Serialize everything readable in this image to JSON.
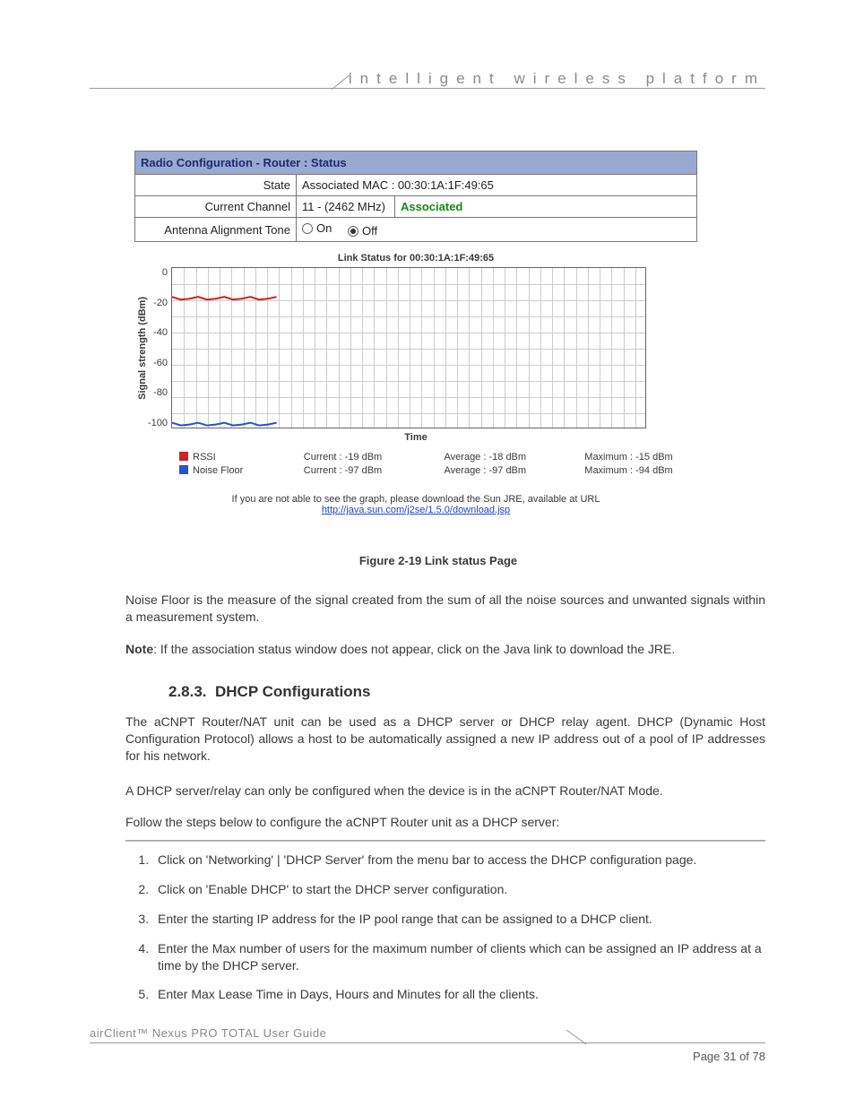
{
  "header": {
    "tagline": "intelligent wireless platform"
  },
  "config_table": {
    "title": "Radio Configuration - Router : Status",
    "rows": {
      "state_label": "State",
      "state_value": "Associated MAC : 00:30:1A:1F:49:65",
      "channel_label": "Current Channel",
      "channel_value": "11 - (2462 MHz)",
      "channel_status": "Associated",
      "tone_label": "Antenna Alignment Tone",
      "tone_on": "On",
      "tone_off": "Off"
    }
  },
  "chart_data": {
    "type": "line",
    "title": "Link Status for 00:30:1A:1F:49:65",
    "xlabel": "Time",
    "ylabel": "Signal strength (dBm)",
    "ylim": [
      -100,
      0
    ],
    "yticks": [
      "0",
      "-20",
      "-40",
      "-60",
      "-80",
      "-100"
    ],
    "series": [
      {
        "name": "RSSI",
        "color": "#c22",
        "approx_level": -19,
        "segment_frac": 0.22
      },
      {
        "name": "Noise Floor",
        "color": "#2255cc",
        "approx_level": -97,
        "segment_frac": 0.22
      }
    ],
    "legend": {
      "rssi": {
        "name": "RSSI",
        "current_label": "Current :",
        "current": "-19 dBm",
        "average_label": "Average :",
        "average": "-18 dBm",
        "maximum_label": "Maximum :",
        "maximum": "-15 dBm"
      },
      "noise": {
        "name": "Noise Floor",
        "current_label": "Current :",
        "current": "-97 dBm",
        "average_label": "Average :",
        "average": "-97 dBm",
        "maximum_label": "Maximum :",
        "maximum": "-94 dBm"
      }
    },
    "jre_note": "If you are not able to see the graph, please download the Sun JRE, available at URL",
    "jre_link": "http://java.sun.com/j2se/1.5.0/download.jsp"
  },
  "figure_caption": "Figure 2-19 Link status Page",
  "paragraphs": {
    "p1": "Noise Floor is the measure of the signal created from the sum of all the noise sources and unwanted signals within a measurement system.",
    "note_label": "Note",
    "note_text": ":   If the association status window does not appear, click on the Java link to download the JRE.",
    "h2_num": "2.8.3.",
    "h2_title": "DHCP Configurations",
    "p3": "The aCNPT Router/NAT unit can be used as a DHCP server or DHCP relay agent. DHCP (Dynamic Host Configuration Protocol) allows a host to be automatically assigned a new IP address out of a pool of IP addresses for his network.",
    "p4": "A DHCP server/relay can only be configured when the device is in the aCNPT Router/NAT Mode.",
    "p5": "Follow the steps below to configure the aCNPT Router unit as a DHCP server:"
  },
  "steps": [
    "Click on 'Networking' | 'DHCP Server' from the menu bar to access the DHCP configuration page.",
    "Click on 'Enable DHCP' to start the DHCP server configuration.",
    "Enter the starting IP address for the IP pool range that can be assigned to a DHCP client.",
    "Enter the Max number of users for the maximum number of clients which can be assigned an IP address at a time by the DHCP server.",
    "Enter Max Lease Time in Days, Hours and Minutes for all the clients."
  ],
  "footer": {
    "left": "airClient™ Nexus PRO TOTAL User Guide",
    "right": "Page 31 of 78"
  }
}
